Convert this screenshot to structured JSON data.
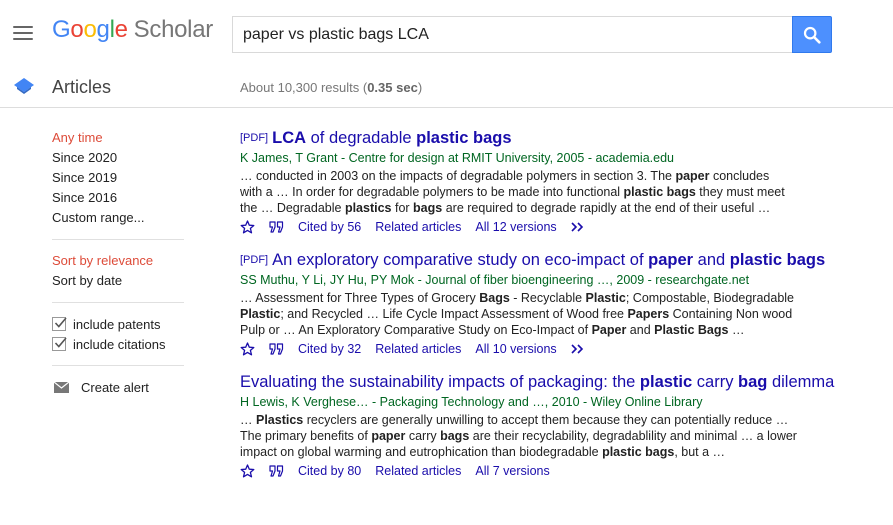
{
  "header": {
    "logo_google": [
      "G",
      "o",
      "o",
      "g",
      "l",
      "e"
    ],
    "logo_colors": [
      "#4285f4",
      "#ea4335",
      "#fbbc05",
      "#4285f4",
      "#34a853",
      "#ea4335"
    ],
    "logo_scholar": "Scholar",
    "search_value": "paper vs plastic bags LCA"
  },
  "subheader": {
    "section_label": "Articles",
    "count_prefix": "About 10,300 results (",
    "count_time": "0.35 sec",
    "count_suffix": ")"
  },
  "sidebar": {
    "time_filters": [
      "Any time",
      "Since 2020",
      "Since 2019",
      "Since 2016",
      "Custom range..."
    ],
    "sort_options": [
      "Sort by relevance",
      "Sort by date"
    ],
    "checkboxes": [
      "include patents",
      "include citations"
    ],
    "create_alert": "Create alert"
  },
  "results": [
    {
      "pdf_tag": "[PDF]",
      "title_parts": [
        {
          "t": "LCA",
          "b": true
        },
        {
          "t": " of degradable ",
          "b": false
        },
        {
          "t": "plastic bags",
          "b": true
        }
      ],
      "authors": "K James, T Grant - Centre for design at RMIT University, 2005 - academia.edu",
      "snippet_lines": [
        [
          {
            "t": "… conducted in 2003 on the impacts of degradable polymers in section 3. The ",
            "b": false
          },
          {
            "t": "paper",
            "b": true
          },
          {
            "t": " concludes",
            "b": false
          }
        ],
        [
          {
            "t": "with a … In order for degradable polymers to be made into functional ",
            "b": false
          },
          {
            "t": "plastic bags",
            "b": true
          },
          {
            "t": " they must meet",
            "b": false
          }
        ],
        [
          {
            "t": "the … Degradable ",
            "b": false
          },
          {
            "t": "plastics",
            "b": true
          },
          {
            "t": " for ",
            "b": false
          },
          {
            "t": "bags",
            "b": true
          },
          {
            "t": " are required to degrade rapidly at the end of their useful …",
            "b": false
          }
        ]
      ],
      "cited_by": "Cited by 56",
      "related": "Related articles",
      "versions": "All 12 versions",
      "has_more": true
    },
    {
      "pdf_tag": "[PDF]",
      "title_parts": [
        {
          "t": "An exploratory comparative study on eco-impact of ",
          "b": false
        },
        {
          "t": "paper",
          "b": true
        },
        {
          "t": " and ",
          "b": false
        },
        {
          "t": "plastic bags",
          "b": true
        }
      ],
      "authors": "SS Muthu, Y Li, JY Hu, PY Mok - Journal of fiber bioengineering …, 2009 - researchgate.net",
      "snippet_lines": [
        [
          {
            "t": "… Assessment for Three Types of Grocery ",
            "b": false
          },
          {
            "t": "Bags",
            "b": true
          },
          {
            "t": " - Recyclable ",
            "b": false
          },
          {
            "t": "Plastic",
            "b": true
          },
          {
            "t": "; Compostable, Biodegradable",
            "b": false
          }
        ],
        [
          {
            "t": "Plastic",
            "b": true
          },
          {
            "t": "; and Recycled … Life Cycle Impact Assessment of Wood free ",
            "b": false
          },
          {
            "t": "Papers",
            "b": true
          },
          {
            "t": " Containing Non wood",
            "b": false
          }
        ],
        [
          {
            "t": "Pulp or … An Exploratory Comparative Study on Eco-Impact of ",
            "b": false
          },
          {
            "t": "Paper",
            "b": true
          },
          {
            "t": " and ",
            "b": false
          },
          {
            "t": "Plastic Bags",
            "b": true
          },
          {
            "t": " …",
            "b": false
          }
        ]
      ],
      "cited_by": "Cited by 32",
      "related": "Related articles",
      "versions": "All 10 versions",
      "has_more": true
    },
    {
      "pdf_tag": "",
      "title_parts": [
        {
          "t": "Evaluating the sustainability impacts of packaging: the ",
          "b": false
        },
        {
          "t": "plastic",
          "b": true
        },
        {
          "t": " carry ",
          "b": false
        },
        {
          "t": "bag",
          "b": true
        },
        {
          "t": " dilemma",
          "b": false
        }
      ],
      "authors": "H Lewis, K Verghese… - Packaging Technology and …, 2010 - Wiley Online Library",
      "snippet_lines": [
        [
          {
            "t": "… ",
            "b": false
          },
          {
            "t": "Plastics",
            "b": true
          },
          {
            "t": " recyclers are generally unwilling to accept them because they can potentially reduce …",
            "b": false
          }
        ],
        [
          {
            "t": "The primary benefits of ",
            "b": false
          },
          {
            "t": "paper",
            "b": true
          },
          {
            "t": " carry ",
            "b": false
          },
          {
            "t": "bags",
            "b": true
          },
          {
            "t": " are their recyclability, degradablility and minimal … a lower",
            "b": false
          }
        ],
        [
          {
            "t": "impact on global warming and eutrophication than biodegradable ",
            "b": false
          },
          {
            "t": "plastic bags",
            "b": true
          },
          {
            "t": ", but a …",
            "b": false
          }
        ]
      ],
      "cited_by": "Cited by 80",
      "related": "Related articles",
      "versions": "All 7 versions",
      "has_more": false
    }
  ],
  "icons": {
    "menu": "hamburger-menu-icon",
    "search": "magnifier-search-icon",
    "articles": "articles-diamond-icon",
    "save": "star-outline-icon",
    "cite": "quote-icon",
    "more": "double-chevron-icon",
    "alert": "envelope-icon",
    "check": "checkmark-icon"
  },
  "colors": {
    "link": "#1a0dab",
    "author": "#006621",
    "active_filter": "#dd4b39",
    "search_button": "#4d90fe",
    "articles_icon": "#4285f4"
  }
}
